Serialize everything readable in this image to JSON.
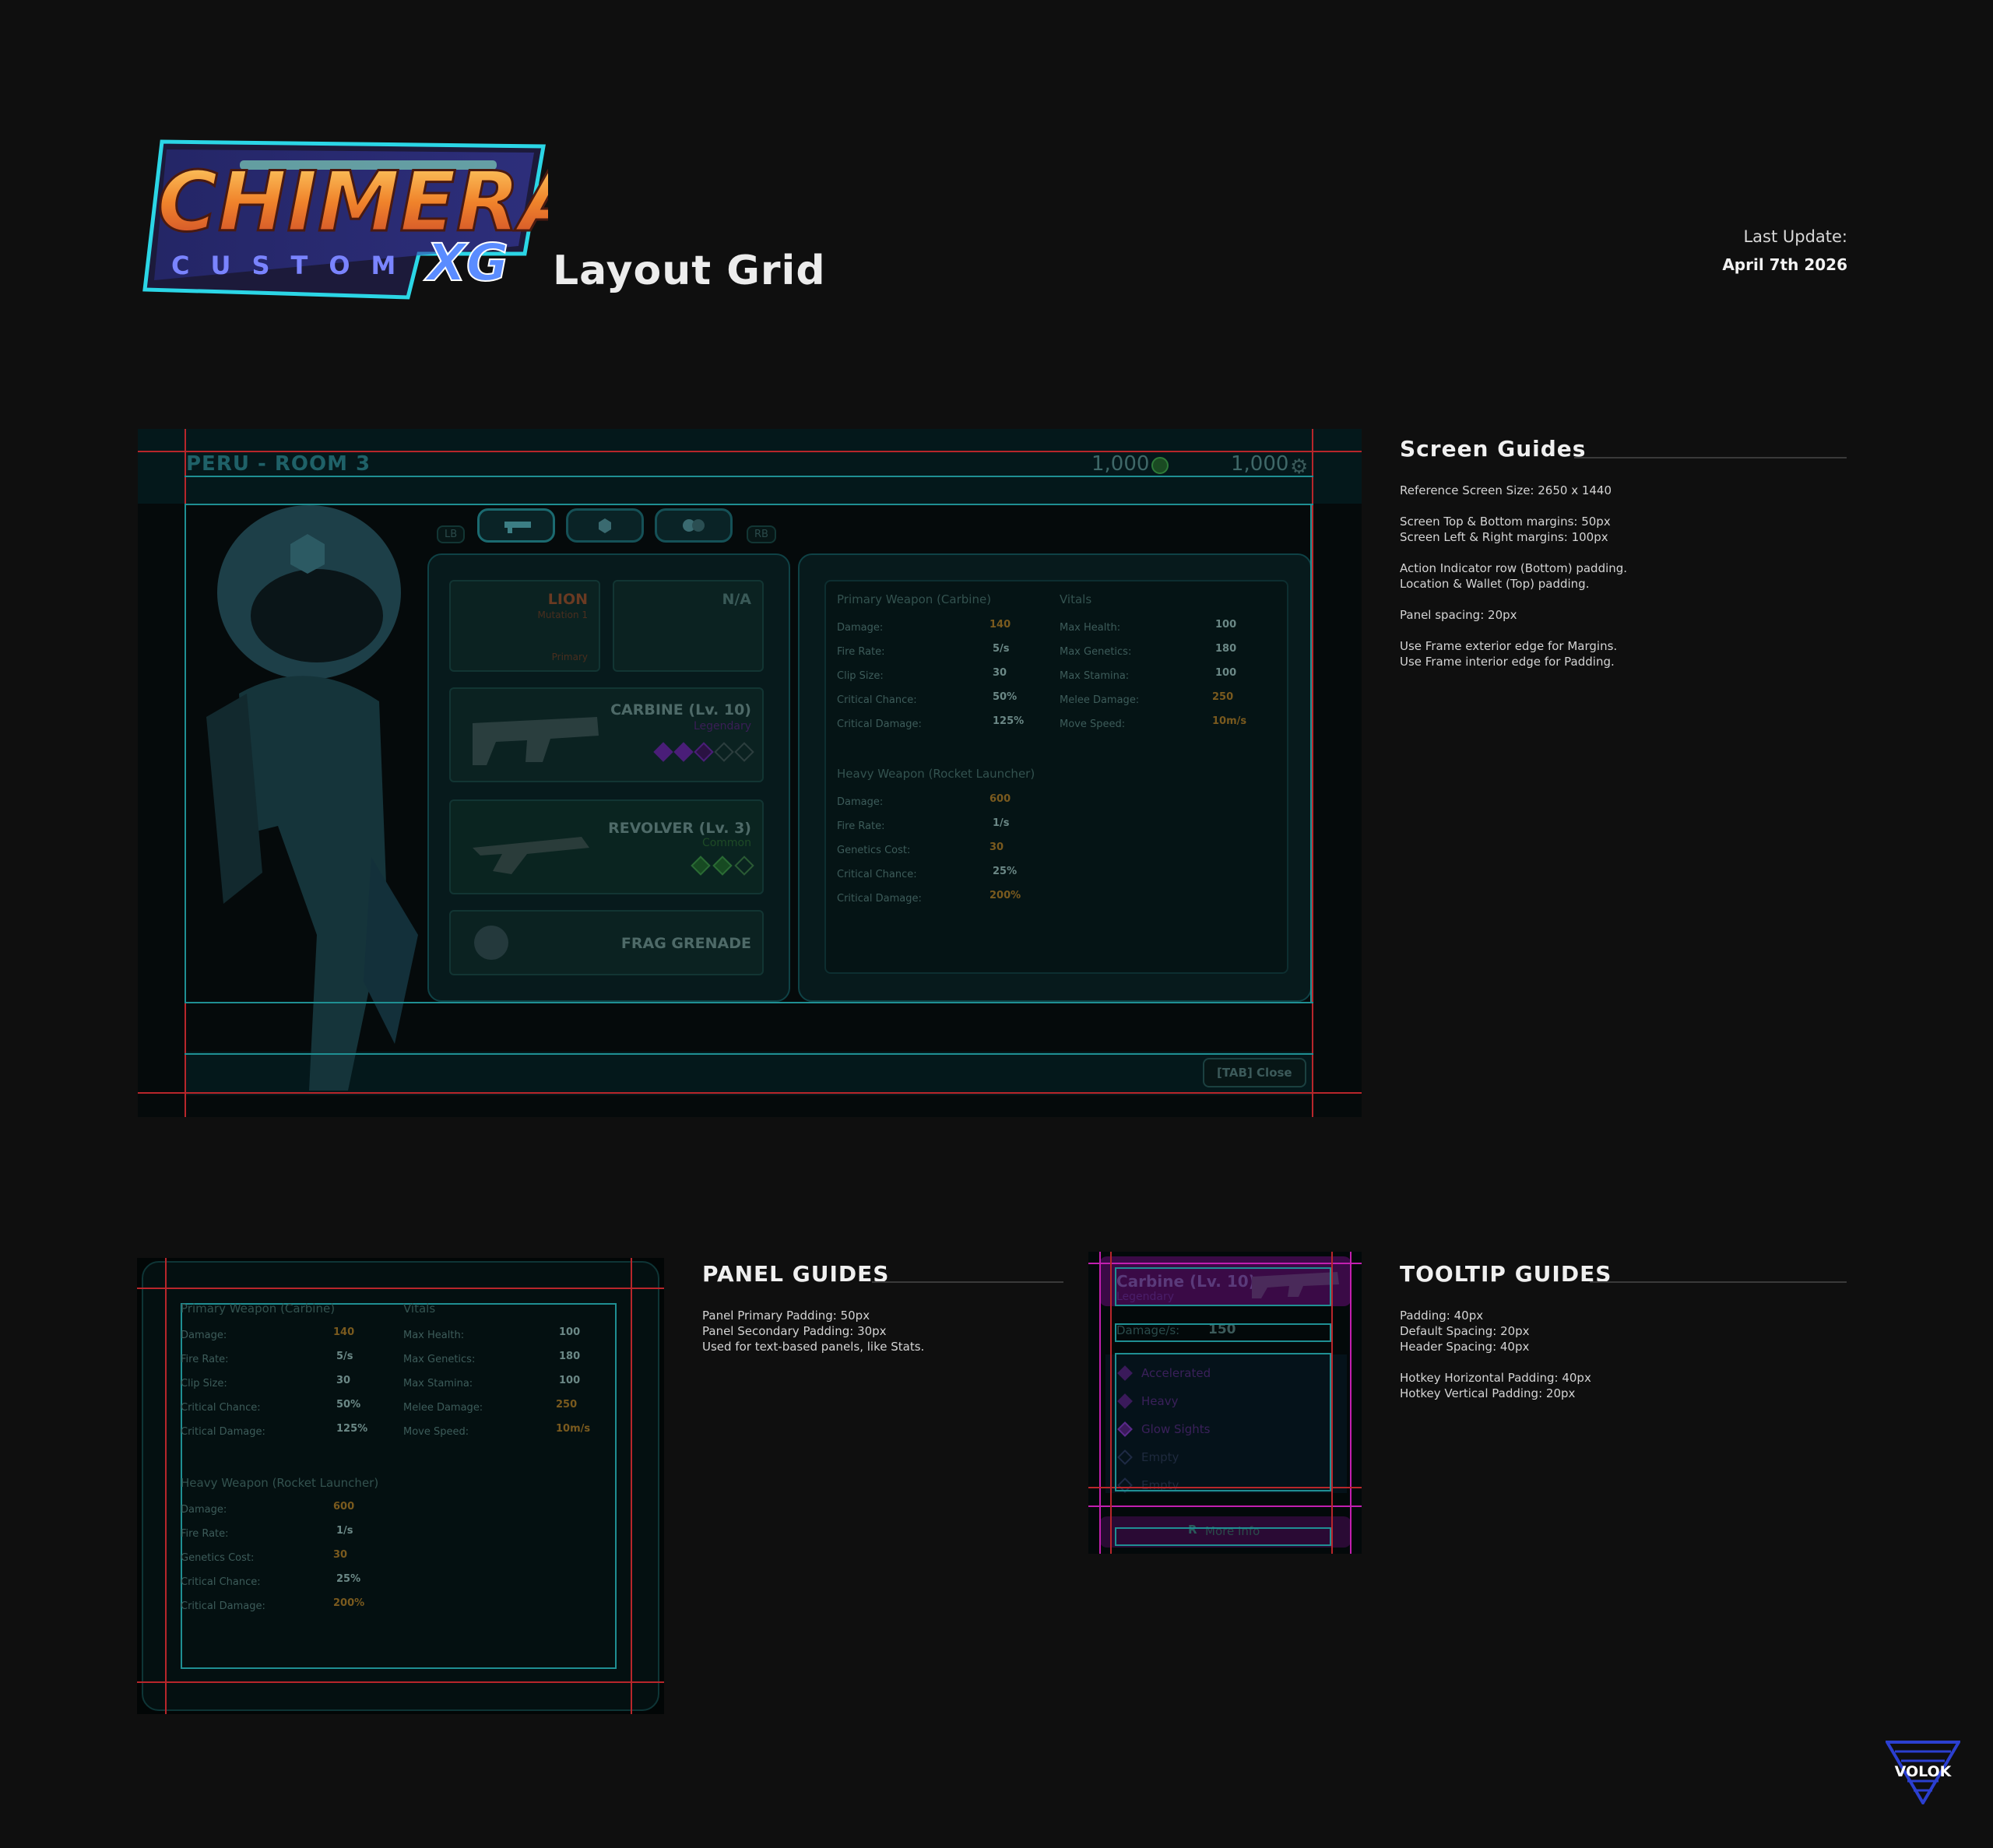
{
  "header": {
    "logo_word": "CHIMERA",
    "logo_sub": "CUSTOM",
    "logo_tag": "XG",
    "page_title": "Layout Grid",
    "last_update_label": "Last Update:",
    "last_update_date": "April 7th 2026"
  },
  "screen_guides": {
    "title": "Screen Guides",
    "lines": [
      "Reference Screen Size: 2650 x 1440",
      "",
      "Screen Top & Bottom margins: 50px",
      "Screen Left & Right margins: 100px",
      "",
      "Action Indicator row (Bottom) padding.",
      "Location & Wallet (Top) padding.",
      "",
      "Panel spacing: 20px",
      "",
      "Use Frame exterior edge for Margins.",
      "Use Frame interior edge for Padding."
    ]
  },
  "panel_guides": {
    "title": "PANEL GUIDES",
    "lines": [
      "Panel Primary Padding: 50px",
      "Panel Secondary Padding: 30px",
      "Used for text-based panels, like Stats."
    ]
  },
  "tooltip_guides": {
    "title": "TOOLTIP GUIDES",
    "lines": [
      "Padding: 40px",
      "Default Spacing: 20px",
      "Header Spacing: 40px",
      "",
      "Hotkey Horizontal Padding: 40px",
      "Hotkey Vertical Padding: 20px"
    ]
  },
  "game_ui": {
    "location": "PERU - ROOM 3",
    "wallet_genetics": "1,000",
    "wallet_parts": "1,000",
    "lb": "LB",
    "rb": "RB",
    "close_hotkey": "[TAB] Close",
    "mutation": {
      "name": "LION",
      "sub": "Mutation 1",
      "slot": "Primary"
    },
    "na_slot": "N/A",
    "weapons": [
      {
        "name": "CARBINE (Lv. 10)",
        "rarity": "Legendary"
      },
      {
        "name": "REVOLVER (Lv. 3)",
        "rarity": "Common"
      },
      {
        "name": "FRAG GRENADE",
        "rarity": ""
      }
    ],
    "primary_header": "Primary Weapon (Carbine)",
    "vitals_header": "Vitals",
    "heavy_header": "Heavy Weapon (Rocket Launcher)",
    "primary_stats": [
      {
        "label": "Damage:",
        "value": "140"
      },
      {
        "label": "Fire Rate:",
        "value": "5/s"
      },
      {
        "label": "Clip Size:",
        "value": "30"
      },
      {
        "label": "Critical Chance:",
        "value": "50%"
      },
      {
        "label": "Critical Damage:",
        "value": "125%"
      }
    ],
    "vitals_stats": [
      {
        "label": "Max Health:",
        "value": "100"
      },
      {
        "label": "Max Genetics:",
        "value": "180"
      },
      {
        "label": "Max Stamina:",
        "value": "100"
      },
      {
        "label": "Melee Damage:",
        "value": "250"
      },
      {
        "label": "Move Speed:",
        "value": "10m/s"
      }
    ],
    "heavy_stats": [
      {
        "label": "Damage:",
        "value": "600"
      },
      {
        "label": "Fire Rate:",
        "value": "1/s"
      },
      {
        "label": "Genetics Cost:",
        "value": "30"
      },
      {
        "label": "Critical Chance:",
        "value": "25%"
      },
      {
        "label": "Critical Damage:",
        "value": "200%"
      }
    ]
  },
  "tooltip": {
    "title": "Carbine (Lv. 10)",
    "rarity": "Legendary",
    "damage_label": "Damage/s:",
    "damage_value": "150",
    "mods": [
      "Accelerated",
      "Heavy",
      "Glow Sights",
      "Empty",
      "Empty"
    ],
    "hotkey_key": "R",
    "hotkey_label": "More Info"
  },
  "footer": {
    "brand": "VOLOK"
  },
  "colors": {
    "guide_red": "#b8262b",
    "guide_cyan": "#1f8f93",
    "tooltip_magenta": "#c21fb0",
    "accent_orange": "#f07a24",
    "legendary_purple": "#6a2aa6"
  }
}
